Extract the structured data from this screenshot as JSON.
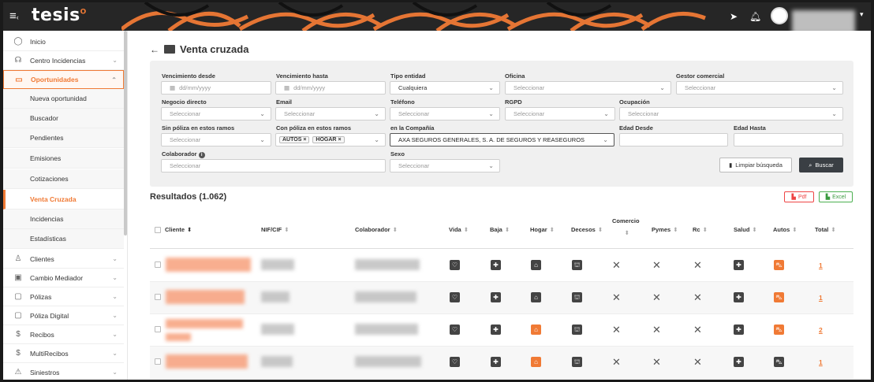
{
  "app": {
    "logo": "tesis",
    "menu_icon": "hamburger-icon"
  },
  "colors": {
    "accent": "#f07a35",
    "topbar": "#262626",
    "dark_icon": "#444444"
  },
  "sidebar": {
    "items": [
      {
        "label": "Inicio",
        "icon": "home-icon",
        "chevron": false
      },
      {
        "label": "Centro Incidencias",
        "icon": "headset-icon",
        "chevron": true
      },
      {
        "label": "Oportunidades",
        "icon": "folder-icon",
        "chevron": true,
        "active": true
      }
    ],
    "subitems": [
      "Nueva oportunidad",
      "Buscador",
      "Pendientes",
      "Emisiones",
      "Cotizaciones",
      "Venta Cruzada",
      "Incidencias",
      "Estadísticas"
    ],
    "current_subitem": "Venta Cruzada",
    "bottom_items": [
      {
        "label": "Clientes",
        "icon": "user-icon"
      },
      {
        "label": "Cambio Mediador",
        "icon": "briefcase-icon"
      },
      {
        "label": "Pólizas",
        "icon": "document-icon"
      },
      {
        "label": "Póliza Digital",
        "icon": "document-icon"
      },
      {
        "label": "Recibos",
        "icon": "dollar-icon"
      },
      {
        "label": "MultiRecibos",
        "icon": "dollar-icon"
      },
      {
        "label": "Siniestros",
        "icon": "warning-icon"
      }
    ]
  },
  "page": {
    "title": "Venta cruzada",
    "back_icon": "arrow-left-icon"
  },
  "filters": {
    "vencimiento_desde": {
      "label": "Vencimiento desde",
      "placeholder": "dd/mm/yyyy"
    },
    "vencimiento_hasta": {
      "label": "Vencimiento hasta",
      "placeholder": "dd/mm/yyyy"
    },
    "tipo_entidad": {
      "label": "Tipo entidad",
      "value": "Cualquiera"
    },
    "oficina": {
      "label": "Oficina",
      "placeholder": "Seleccionar"
    },
    "gestor_comercial": {
      "label": "Gestor comercial",
      "placeholder": "Seleccionar"
    },
    "negocio_directo": {
      "label": "Negocio directo",
      "placeholder": "Seleccionar"
    },
    "email": {
      "label": "Email",
      "placeholder": "Seleccionar"
    },
    "telefono": {
      "label": "Teléfono",
      "placeholder": "Seleccionar"
    },
    "rgpd": {
      "label": "RGPD",
      "placeholder": "Seleccionar"
    },
    "ocupacion": {
      "label": "Ocupación",
      "placeholder": "Seleccionar"
    },
    "sin_poliza": {
      "label": "Sin póliza en estos ramos",
      "placeholder": "Seleccionar"
    },
    "con_poliza": {
      "label": "Con póliza en estos ramos",
      "tags": [
        "AUTOS",
        "HOGAR"
      ]
    },
    "compania": {
      "label": "en la Compañía",
      "value": "AXA SEGUROS GENERALES, S. A. DE SEGUROS Y REASEGUROS"
    },
    "edad_desde": {
      "label": "Edad Desde"
    },
    "edad_hasta": {
      "label": "Edad Hasta"
    },
    "colaborador": {
      "label": "Colaborador",
      "placeholder": "Seleccionar"
    },
    "sexo": {
      "label": "Sexo",
      "placeholder": "Seleccionar"
    },
    "clear_button": "Limpiar búsqueda",
    "search_button": "Buscar"
  },
  "results": {
    "title": "Resultados (1.062)",
    "pdf_button": "Pdf",
    "excel_button": "Excel",
    "columns": [
      "Cliente",
      "NIF/CIF",
      "Colaborador",
      "Vida",
      "Baja",
      "Hogar",
      "Decesos",
      "Comercio",
      "Pymes",
      "Rc",
      "Salud",
      "Autos",
      "Total"
    ],
    "rows": [
      {
        "vida": "heart",
        "baja": "medical",
        "hogar": "home",
        "decesos": "funeral",
        "comercio": "x",
        "pymes": "x",
        "rc": "x",
        "salud": "medical",
        "autos": "car-orange",
        "total": "1"
      },
      {
        "vida": "heart",
        "baja": "medical",
        "hogar": "home",
        "decesos": "funeral",
        "comercio": "x",
        "pymes": "x",
        "rc": "x",
        "salud": "medical",
        "autos": "car-orange",
        "total": "1"
      },
      {
        "vida": "heart",
        "baja": "medical",
        "hogar": "home-orange",
        "decesos": "funeral",
        "comercio": "x",
        "pymes": "x",
        "rc": "x",
        "salud": "medical",
        "autos": "car-orange",
        "total": "2"
      },
      {
        "vida": "heart",
        "baja": "medical",
        "hogar": "home-orange",
        "decesos": "funeral",
        "comercio": "x",
        "pymes": "x",
        "rc": "x",
        "salud": "medical",
        "autos": "car",
        "total": "1"
      }
    ]
  }
}
